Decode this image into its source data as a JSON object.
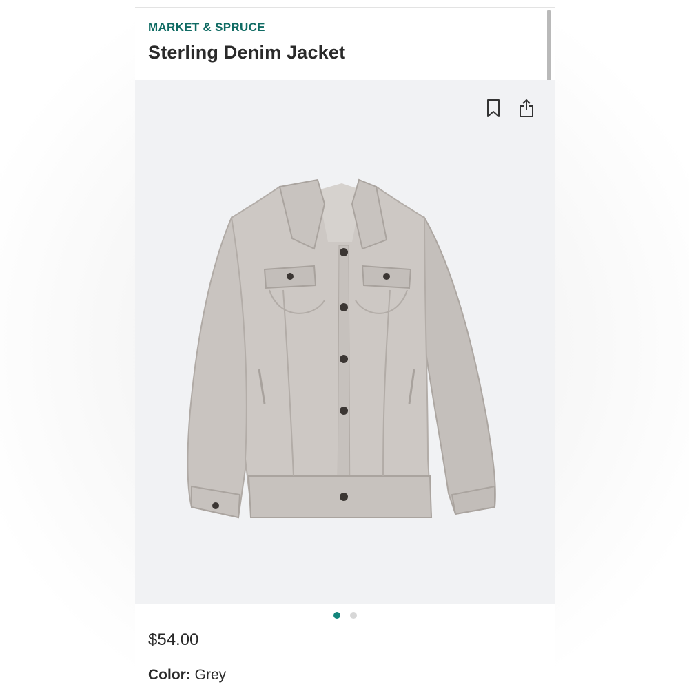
{
  "product": {
    "brand": "MARKET & SPRUCE",
    "title": "Sterling Denim Jacket",
    "price": "$54.00",
    "color_label": "Color:",
    "color_value": "Grey"
  },
  "gallery": {
    "image_count": 2,
    "active_index": 0,
    "image_subject": "grey denim jacket"
  },
  "icons": {
    "bookmark": "bookmark-icon",
    "share": "share-icon"
  },
  "colors": {
    "brand_teal": "#0f6b63",
    "active_dot": "#13857b",
    "inactive_dot": "#d7d7d7",
    "text": "#2a2a2a",
    "media_bg": "#f1f2f4",
    "jacket_grey": "#c4bfbb"
  }
}
